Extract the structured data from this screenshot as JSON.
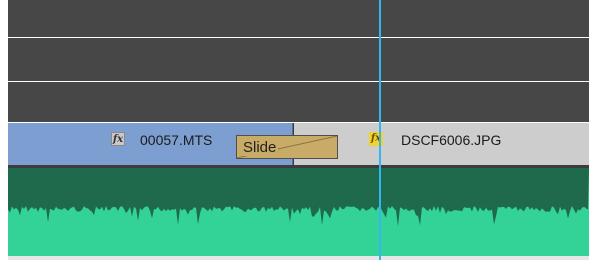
{
  "colors": {
    "lane_background": "#474747",
    "clip_a": "#7d9ed0",
    "clip_b": "#cdcdcd",
    "transition": "#c9ab68",
    "audio": "#33d397",
    "audio_waveform": "#1f6a4c",
    "playhead": "#35b6ef"
  },
  "video_track": {
    "clips": [
      {
        "name": "00057.MTS",
        "fx_icon": "fx-icon",
        "fx_label": "fx"
      },
      {
        "name": "DSCF6006.JPG",
        "fx_icon": "fx-icon-active",
        "fx_label": "fx"
      }
    ],
    "transition": {
      "label": "Slide"
    }
  },
  "audio_track": {
    "waveform": "audio-waveform"
  }
}
